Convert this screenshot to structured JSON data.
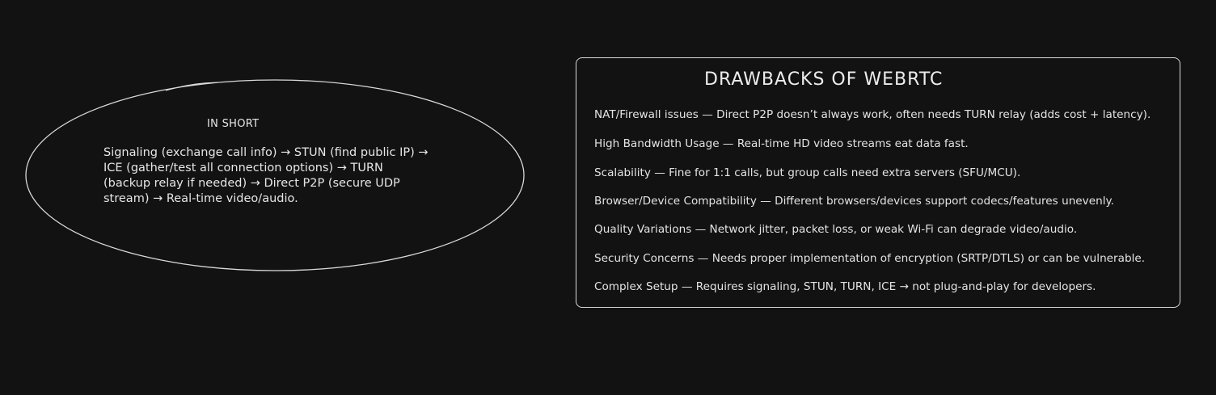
{
  "summary": {
    "title": "IN SHORT",
    "lines": [
      "Signaling (exchange call info) → STUN (find public IP) →",
      "ICE (gather/test all connection options) → TURN",
      "(backup relay if needed) → Direct P2P (secure UDP",
      "stream) → Real-time video/audio."
    ]
  },
  "drawbacks": {
    "title": "DRAWBACKS OF WEBRTC",
    "items": [
      "NAT/Firewall issues — Direct P2P doesn’t always work, often needs TURN relay (adds cost + latency).",
      "High Bandwidth Usage — Real-time HD video streams eat data fast.",
      "Scalability — Fine for 1:1 calls, but group calls need extra servers (SFU/MCU).",
      "Browser/Device Compatibility — Different browsers/devices support codecs/features unevenly.",
      "Quality Variations — Network jitter, packet loss, or weak Wi-Fi can degrade video/audio.",
      "Security Concerns — Needs proper implementation of encryption (SRTP/DTLS) or can be vulnerable.",
      "Complex Setup — Requires signaling, STUN, TURN, ICE → not plug-and-play for developers."
    ]
  },
  "colors": {
    "background": "#121212",
    "stroke": "#d9d9d9",
    "text": "#e6e6e6"
  }
}
